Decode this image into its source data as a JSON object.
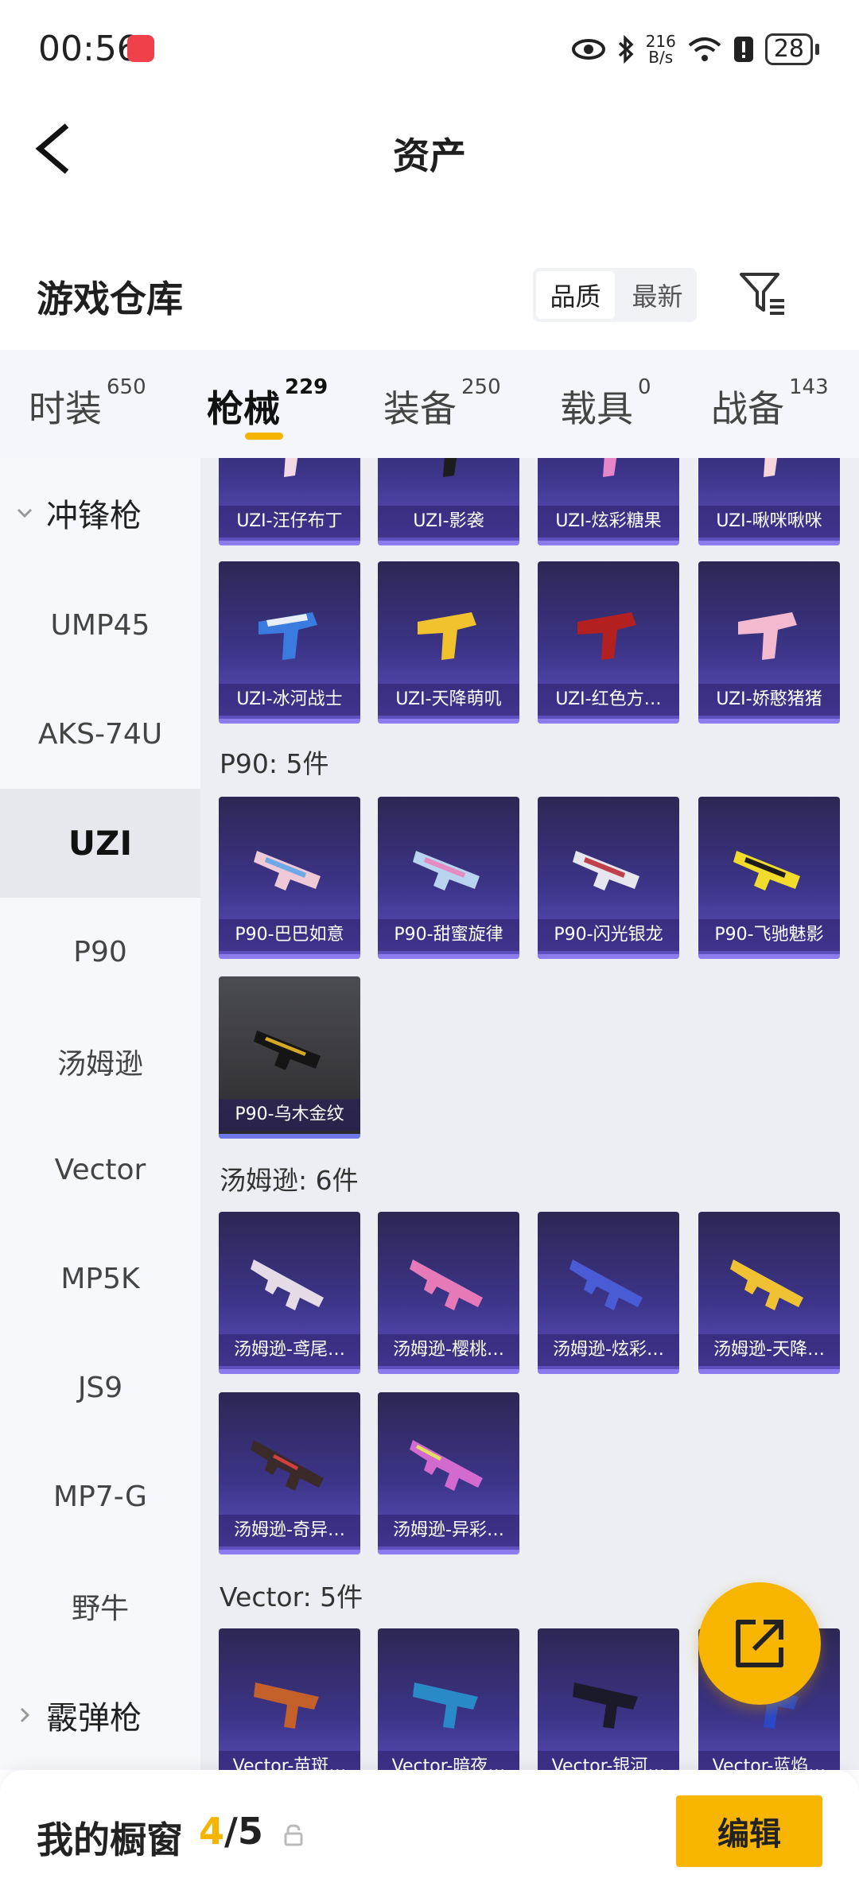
{
  "status_bar": {
    "time": "00:56",
    "net_speed_value": "216",
    "net_speed_unit": "B/s",
    "battery": "28"
  },
  "header": {
    "title": "资产"
  },
  "warehouse": {
    "title": "游戏仓库",
    "sort_options": [
      "品质",
      "最新"
    ],
    "sort_active": "品质"
  },
  "tabs": [
    {
      "label": "时装",
      "count": "650"
    },
    {
      "label": "枪械",
      "count": "229"
    },
    {
      "label": "装备",
      "count": "250"
    },
    {
      "label": "载具",
      "count": "0"
    },
    {
      "label": "战备",
      "count": "143"
    }
  ],
  "active_tab": "枪械",
  "sidebar": {
    "group1": "冲锋枪",
    "items": [
      "UMP45",
      "AKS-74U",
      "UZI",
      "P90",
      "汤姆逊",
      "Vector",
      "MP5K",
      "JS9",
      "MP7-G",
      "野牛"
    ],
    "active_item": "UZI",
    "group2": "霰弹枪"
  },
  "content": {
    "uzi_row1": [
      "UZI-汪仔布丁",
      "UZI-影袭",
      "UZI-炫彩糖果",
      "UZI-啾咪啾咪"
    ],
    "uzi_row2": [
      "UZI-冰河战士",
      "UZI-天降萌叽",
      "UZI-红色方…",
      "UZI-娇憨猪猪"
    ],
    "p90_title": "P90: 5件",
    "p90_items": [
      "P90-巴巴如意",
      "P90-甜蜜旋律",
      "P90-闪光银龙",
      "P90-飞驰魅影",
      "P90-乌木金纹"
    ],
    "thompson_title": "汤姆逊: 6件",
    "thompson_items": [
      "汤姆逊-鸢尾…",
      "汤姆逊-樱桃…",
      "汤姆逊-炫彩…",
      "汤姆逊-天降…",
      "汤姆逊-奇异…",
      "汤姆逊-异彩…"
    ],
    "vector_title": "Vector: 5件",
    "vector_items": [
      "Vector-苗斑…",
      "Vector-暗夜…",
      "Vector-银河…",
      "Vector-蓝焰…"
    ]
  },
  "bottom_bar": {
    "title": "我的橱窗",
    "count_current": "4",
    "count_total": "/5",
    "edit_label": "编辑"
  },
  "colors": {
    "accent": "#f7b500",
    "card_purple": "#3c3488",
    "card_dark": "#38383d"
  },
  "icons": [
    "back-arrow-icon",
    "filter-icon",
    "chevron-down-icon",
    "chevron-right-icon",
    "lock-icon",
    "share-external-icon",
    "eye-icon",
    "bluetooth-icon",
    "wifi-icon",
    "alert-icon"
  ]
}
